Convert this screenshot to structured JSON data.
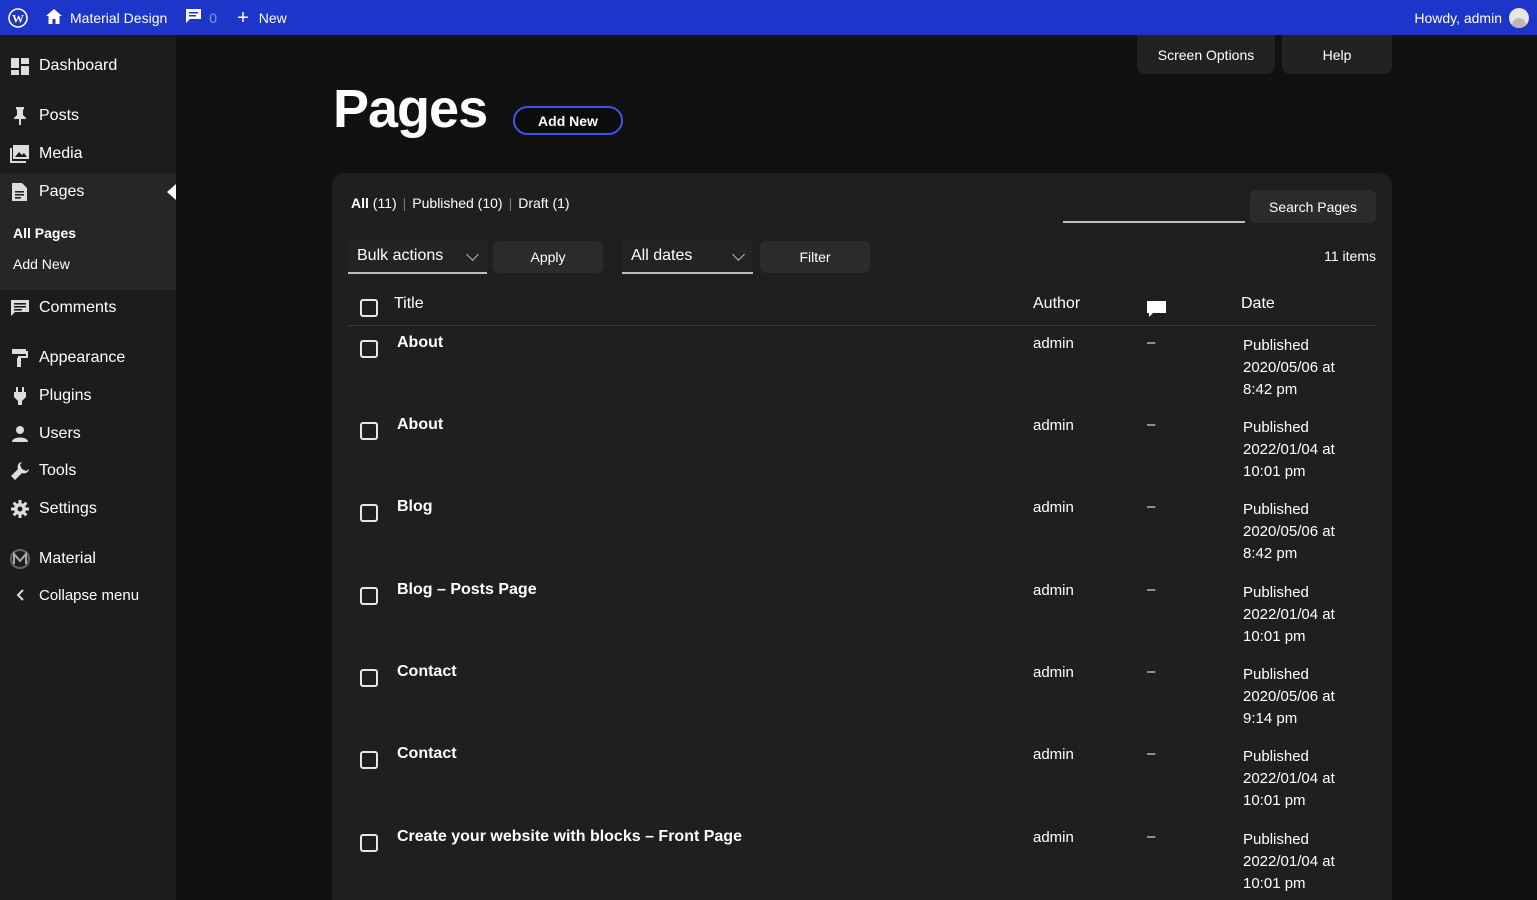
{
  "adminbar": {
    "site_name": "Material Design",
    "comment_count": "0",
    "new_label": "New",
    "greeting": "Howdy, admin"
  },
  "sidebar": {
    "items": [
      {
        "label": "Dashboard",
        "icon": "dashboard-icon"
      },
      {
        "label": "Posts",
        "icon": "pin-icon"
      },
      {
        "label": "Media",
        "icon": "media-icon"
      },
      {
        "label": "Pages",
        "icon": "page-icon"
      },
      {
        "label": "Comments",
        "icon": "comment-icon"
      },
      {
        "label": "Appearance",
        "icon": "brush-icon"
      },
      {
        "label": "Plugins",
        "icon": "plug-icon"
      },
      {
        "label": "Users",
        "icon": "user-icon"
      },
      {
        "label": "Tools",
        "icon": "wrench-icon"
      },
      {
        "label": "Settings",
        "icon": "gear-icon"
      },
      {
        "label": "Material",
        "icon": "material-logo-icon"
      },
      {
        "label": "Collapse menu",
        "icon": "chevron-left-icon"
      }
    ],
    "submenu": [
      "All Pages",
      "Add New"
    ]
  },
  "screen_meta": {
    "screen_options": "Screen Options",
    "help": "Help"
  },
  "header": {
    "title": "Pages",
    "add_new": "Add New"
  },
  "filters": {
    "views": [
      {
        "label": "All",
        "count": "(11)"
      },
      {
        "label": "Published",
        "count": "(10)"
      },
      {
        "label": "Draft",
        "count": "(1)"
      }
    ],
    "search_button": "Search Pages",
    "bulk_actions": "Bulk actions",
    "apply": "Apply",
    "all_dates": "All dates",
    "filter": "Filter",
    "items_count": "11 items"
  },
  "table": {
    "columns": {
      "title": "Title",
      "author": "Author",
      "date": "Date"
    },
    "rows": [
      {
        "title": "About",
        "author": "admin",
        "comments": "–",
        "status": "Published",
        "date": "2020/05/06 at",
        "time": "8:42 pm"
      },
      {
        "title": "About",
        "author": "admin",
        "comments": "–",
        "status": "Published",
        "date": "2022/01/04 at",
        "time": "10:01 pm"
      },
      {
        "title": "Blog",
        "author": "admin",
        "comments": "–",
        "status": "Published",
        "date": "2020/05/06 at",
        "time": "8:42 pm"
      },
      {
        "title": "Blog – Posts Page",
        "author": "admin",
        "comments": "–",
        "status": "Published",
        "date": "2022/01/04 at",
        "time": "10:01 pm"
      },
      {
        "title": "Contact",
        "author": "admin",
        "comments": "–",
        "status": "Published",
        "date": "2020/05/06 at",
        "time": "9:14 pm"
      },
      {
        "title": "Contact",
        "author": "admin",
        "comments": "–",
        "status": "Published",
        "date": "2022/01/04 at",
        "time": "10:01 pm"
      },
      {
        "title": "Create your website with blocks – Front Page",
        "author": "admin",
        "comments": "–",
        "status": "Published",
        "date": "2022/01/04 at",
        "time": "10:01 pm"
      }
    ]
  },
  "colors": {
    "adminbar": "#1d35c9",
    "background": "#111111",
    "sidebar": "#1c1c1c",
    "panel": "#1f1f1f",
    "accent": "#3f55e6"
  }
}
